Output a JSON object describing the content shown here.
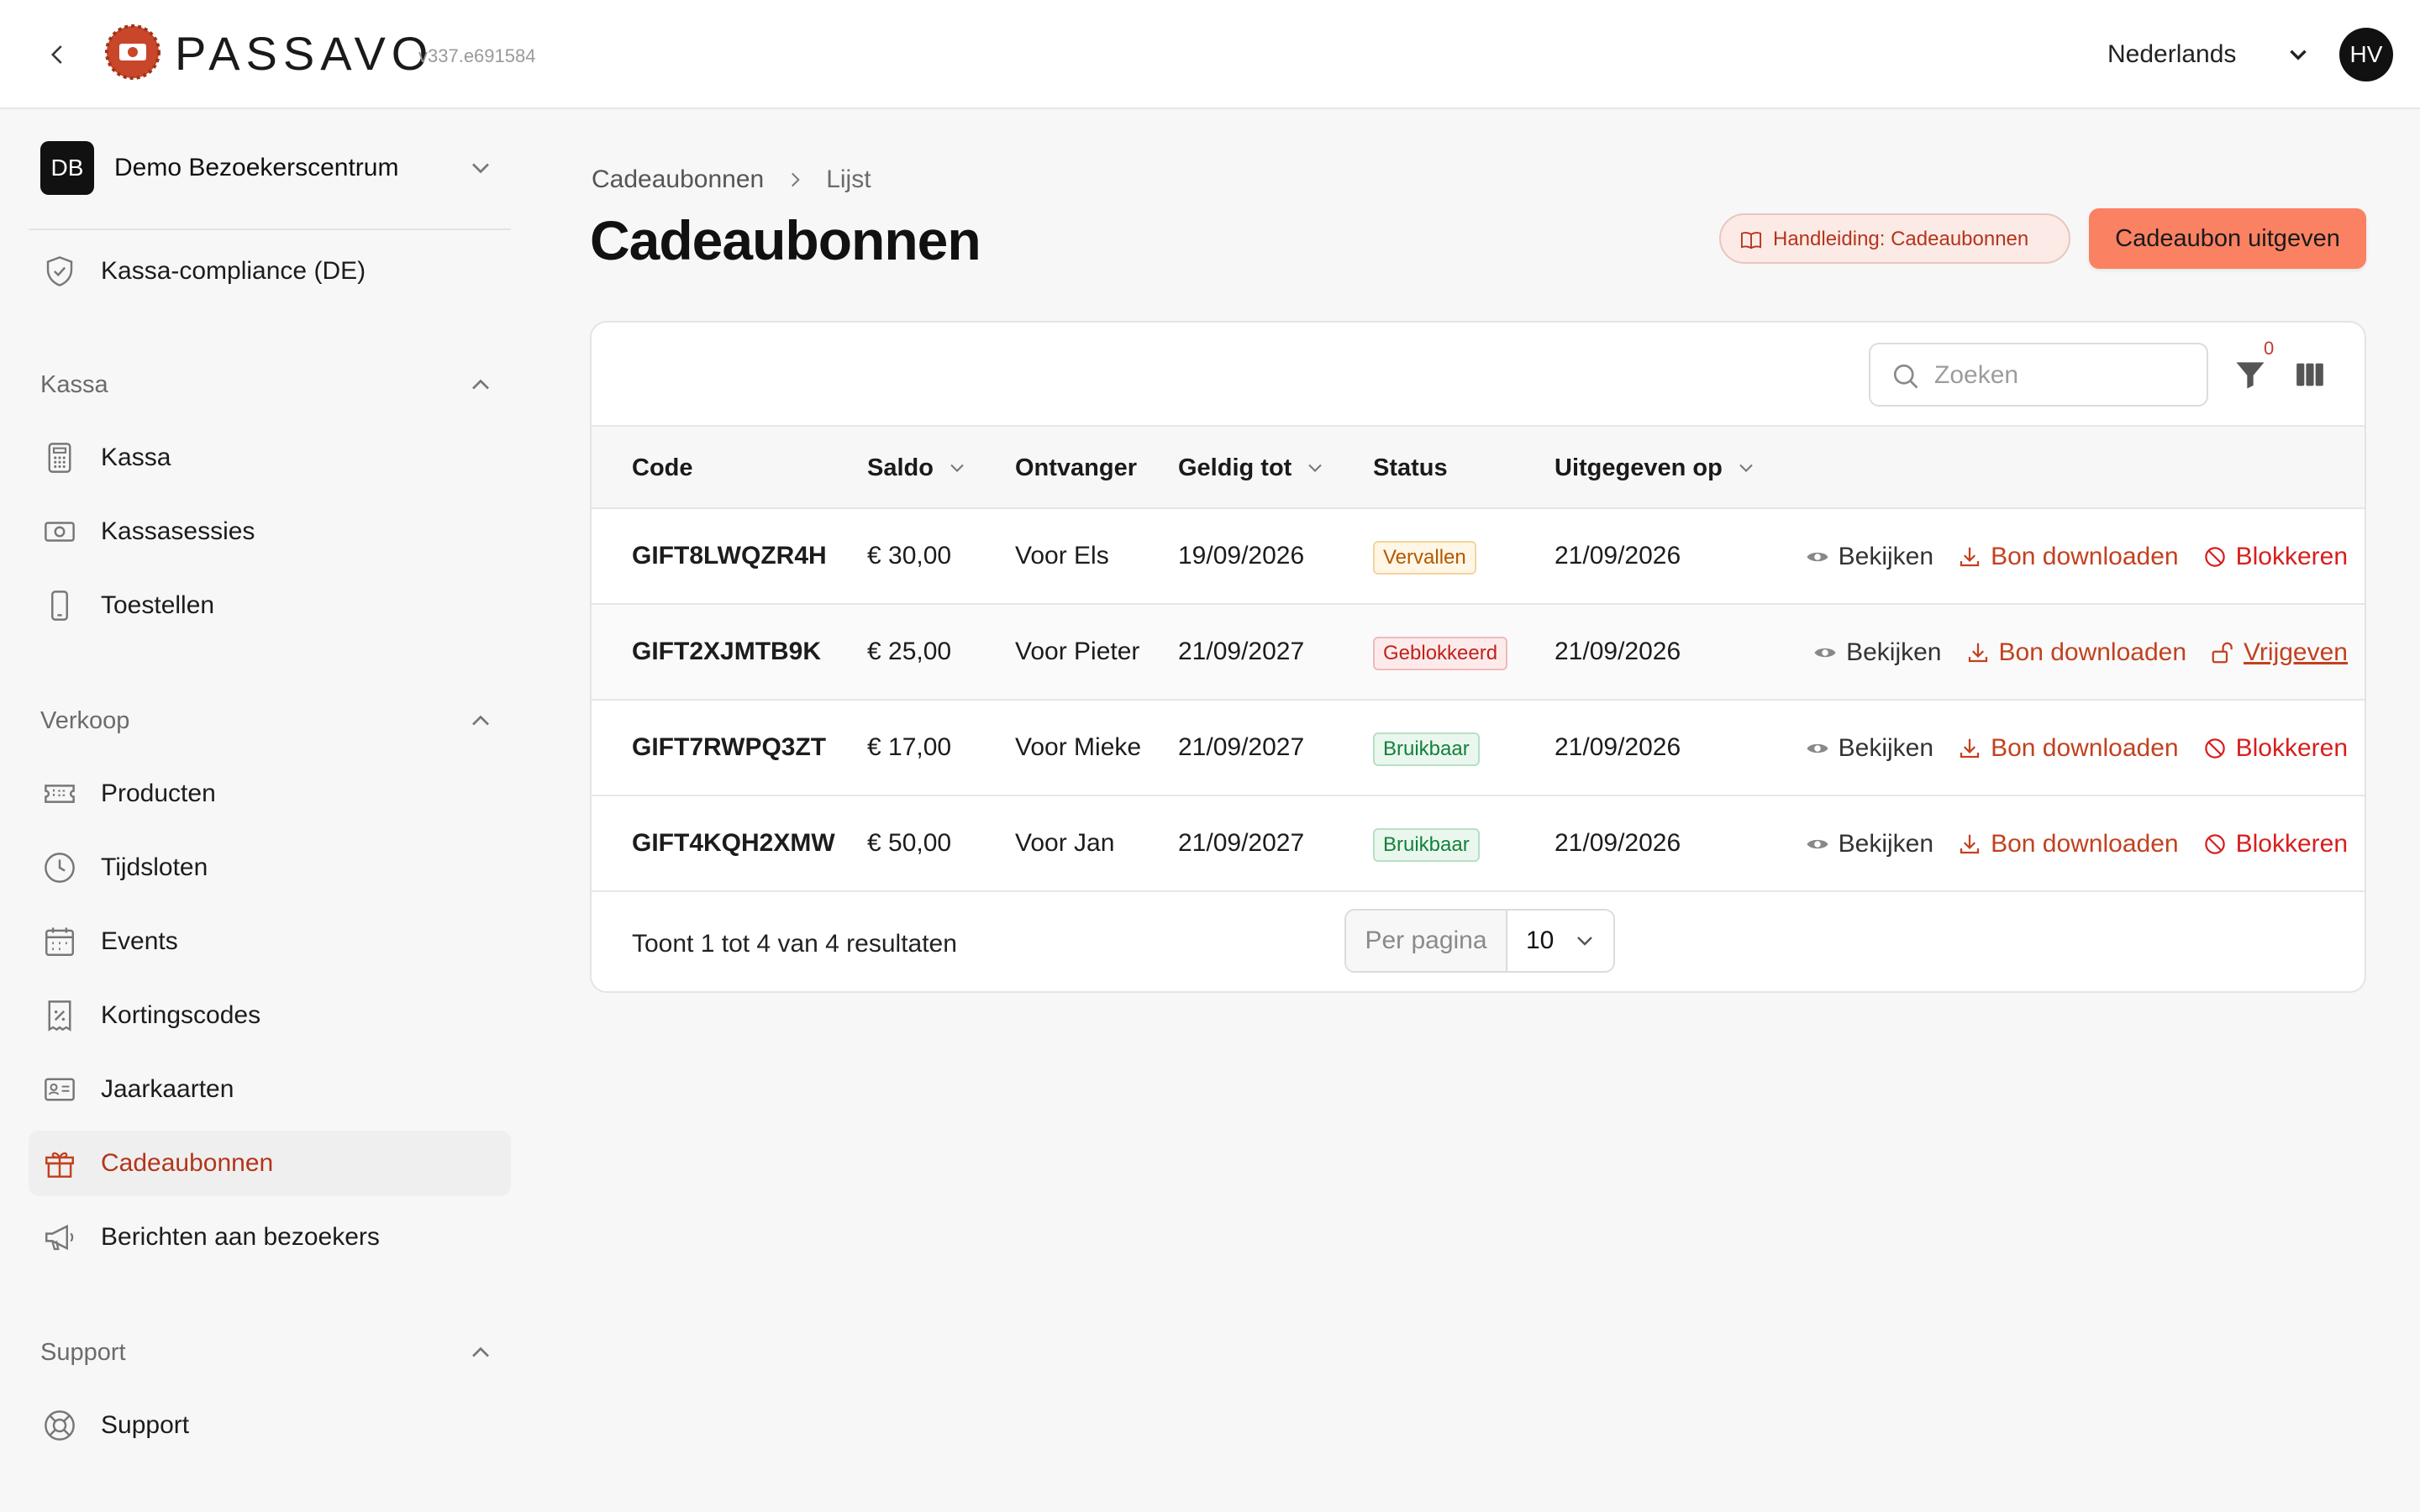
{
  "header": {
    "brand": "PASSAVO",
    "version": "v337.e691584",
    "language": "Nederlands",
    "user_initials": "HV"
  },
  "sidebar": {
    "org_initials": "DB",
    "org_name": "Demo Bezoekerscentrum",
    "compliance_label": "Kassa-compliance (DE)",
    "sections": [
      {
        "label": "Kassa",
        "items": [
          {
            "label": "Kassa",
            "icon": "calculator-icon"
          },
          {
            "label": "Kassasessies",
            "icon": "cash-icon"
          },
          {
            "label": "Toestellen",
            "icon": "phone-icon"
          }
        ]
      },
      {
        "label": "Verkoop",
        "items": [
          {
            "label": "Producten",
            "icon": "ticket-icon"
          },
          {
            "label": "Tijdsloten",
            "icon": "clock-icon"
          },
          {
            "label": "Events",
            "icon": "calendar-icon"
          },
          {
            "label": "Kortingscodes",
            "icon": "discount-icon"
          },
          {
            "label": "Jaarkaarten",
            "icon": "id-card-icon"
          },
          {
            "label": "Cadeaubonnen",
            "icon": "gift-icon",
            "active": true
          },
          {
            "label": "Berichten aan bezoekers",
            "icon": "megaphone-icon"
          }
        ]
      },
      {
        "label": "Support",
        "items": [
          {
            "label": "Support",
            "icon": "lifebuoy-icon"
          }
        ]
      }
    ]
  },
  "breadcrumb": {
    "parent": "Cadeaubonnen",
    "current": "Lijst"
  },
  "page": {
    "title": "Cadeaubonnen",
    "guide_label": "Handleiding: Cadeaubonnen",
    "primary_label": "Cadeaubon uitgeven"
  },
  "toolbar": {
    "search_placeholder": "Zoeken",
    "filter_count": "0"
  },
  "table": {
    "columns": [
      "Code",
      "Saldo",
      "Ontvanger",
      "Geldig tot",
      "Status",
      "Uitgegeven op"
    ],
    "rows": [
      {
        "code": "GIFT8LWQZR4H",
        "saldo": "€ 30,00",
        "ontvanger": "Voor Els",
        "geldig_tot": "19/09/2026",
        "status": "Vervallen",
        "uitgegeven_op": "21/09/2026",
        "view": "Bekijken",
        "download": "Bon downloaden",
        "toggle": "Blokkeren"
      },
      {
        "code": "GIFT2XJMTB9K",
        "saldo": "€ 25,00",
        "ontvanger": "Voor Pieter",
        "geldig_tot": "21/09/2027",
        "status": "Geblokkeerd",
        "uitgegeven_op": "21/09/2026",
        "view": "Bekijken",
        "download": "Bon downloaden",
        "toggle": "Vrijgeven"
      },
      {
        "code": "GIFT7RWPQ3ZT",
        "saldo": "€ 17,00",
        "ontvanger": "Voor Mieke",
        "geldig_tot": "21/09/2027",
        "status": "Bruikbaar",
        "uitgegeven_op": "21/09/2026",
        "view": "Bekijken",
        "download": "Bon downloaden",
        "toggle": "Blokkeren"
      },
      {
        "code": "GIFT4KQH2XMW",
        "saldo": "€ 50,00",
        "ontvanger": "Voor Jan",
        "geldig_tot": "21/09/2027",
        "status": "Bruikbaar",
        "uitgegeven_op": "21/09/2026",
        "view": "Bekijken",
        "download": "Bon downloaden",
        "toggle": "Blokkeren"
      }
    ]
  },
  "footer": {
    "results_text": "Toont 1 tot 4 van 4 resultaten",
    "per_page_label": "Per pagina",
    "per_page_value": "10"
  },
  "colors": {
    "accent": "#b4351a",
    "primary_button": "#fa8162",
    "danger": "#d61f1f"
  }
}
